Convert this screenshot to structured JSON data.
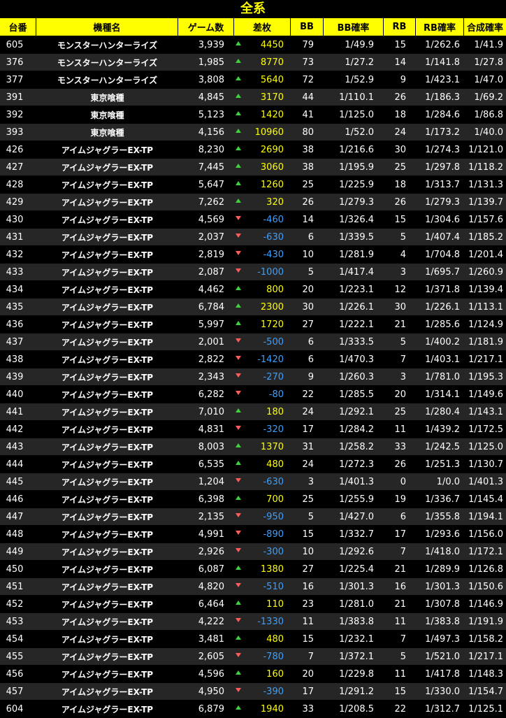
{
  "title": "全系",
  "colors": {
    "header_bg": "#ffff00",
    "positive_value": "#ffff00",
    "negative_value": "#3aa0ff",
    "up_arrow": "#3bd23b",
    "down_arrow": "#ff5c5c"
  },
  "headers": {
    "no": "台番",
    "name": "機種名",
    "games": "ゲーム数",
    "diff": "差枚",
    "bb": "BB",
    "bb_prob": "BB確率",
    "rb": "RB",
    "rb_prob": "RB確率",
    "total_prob": "合成確率"
  },
  "rows": [
    {
      "no": "605",
      "name": "モンスターハンターライズ",
      "games": "3,939",
      "diff": "4450",
      "dir": "up",
      "bb": "79",
      "bb_prob": "1/49.9",
      "rb": "15",
      "rb_prob": "1/262.6",
      "total_prob": "1/41.9"
    },
    {
      "no": "376",
      "name": "モンスターハンターライズ",
      "games": "1,985",
      "diff": "8770",
      "dir": "up",
      "bb": "73",
      "bb_prob": "1/27.2",
      "rb": "14",
      "rb_prob": "1/141.8",
      "total_prob": "1/27.8"
    },
    {
      "no": "377",
      "name": "モンスターハンターライズ",
      "games": "3,808",
      "diff": "5640",
      "dir": "up",
      "bb": "72",
      "bb_prob": "1/52.9",
      "rb": "9",
      "rb_prob": "1/423.1",
      "total_prob": "1/47.0"
    },
    {
      "no": "391",
      "name": "東京喰種",
      "games": "4,845",
      "diff": "3170",
      "dir": "up",
      "bb": "44",
      "bb_prob": "1/110.1",
      "rb": "26",
      "rb_prob": "1/186.3",
      "total_prob": "1/69.2"
    },
    {
      "no": "392",
      "name": "東京喰種",
      "games": "5,123",
      "diff": "1420",
      "dir": "up",
      "bb": "41",
      "bb_prob": "1/125.0",
      "rb": "18",
      "rb_prob": "1/284.6",
      "total_prob": "1/86.8"
    },
    {
      "no": "393",
      "name": "東京喰種",
      "games": "4,156",
      "diff": "10960",
      "dir": "up",
      "bb": "80",
      "bb_prob": "1/52.0",
      "rb": "24",
      "rb_prob": "1/173.2",
      "total_prob": "1/40.0"
    },
    {
      "no": "426",
      "name": "アイムジャグラーEX-TP",
      "games": "8,230",
      "diff": "2690",
      "dir": "up",
      "bb": "38",
      "bb_prob": "1/216.6",
      "rb": "30",
      "rb_prob": "1/274.3",
      "total_prob": "1/121.0"
    },
    {
      "no": "427",
      "name": "アイムジャグラーEX-TP",
      "games": "7,445",
      "diff": "3060",
      "dir": "up",
      "bb": "38",
      "bb_prob": "1/195.9",
      "rb": "25",
      "rb_prob": "1/297.8",
      "total_prob": "1/118.2"
    },
    {
      "no": "428",
      "name": "アイムジャグラーEX-TP",
      "games": "5,647",
      "diff": "1260",
      "dir": "up",
      "bb": "25",
      "bb_prob": "1/225.9",
      "rb": "18",
      "rb_prob": "1/313.7",
      "total_prob": "1/131.3"
    },
    {
      "no": "429",
      "name": "アイムジャグラーEX-TP",
      "games": "7,262",
      "diff": "320",
      "dir": "up",
      "bb": "26",
      "bb_prob": "1/279.3",
      "rb": "26",
      "rb_prob": "1/279.3",
      "total_prob": "1/139.7"
    },
    {
      "no": "430",
      "name": "アイムジャグラーEX-TP",
      "games": "4,569",
      "diff": "-460",
      "dir": "down",
      "bb": "14",
      "bb_prob": "1/326.4",
      "rb": "15",
      "rb_prob": "1/304.6",
      "total_prob": "1/157.6"
    },
    {
      "no": "431",
      "name": "アイムジャグラーEX-TP",
      "games": "2,037",
      "diff": "-630",
      "dir": "down",
      "bb": "6",
      "bb_prob": "1/339.5",
      "rb": "5",
      "rb_prob": "1/407.4",
      "total_prob": "1/185.2"
    },
    {
      "no": "432",
      "name": "アイムジャグラーEX-TP",
      "games": "2,819",
      "diff": "-430",
      "dir": "down",
      "bb": "10",
      "bb_prob": "1/281.9",
      "rb": "4",
      "rb_prob": "1/704.8",
      "total_prob": "1/201.4"
    },
    {
      "no": "433",
      "name": "アイムジャグラーEX-TP",
      "games": "2,087",
      "diff": "-1000",
      "dir": "down",
      "bb": "5",
      "bb_prob": "1/417.4",
      "rb": "3",
      "rb_prob": "1/695.7",
      "total_prob": "1/260.9"
    },
    {
      "no": "434",
      "name": "アイムジャグラーEX-TP",
      "games": "4,462",
      "diff": "800",
      "dir": "up",
      "bb": "20",
      "bb_prob": "1/223.1",
      "rb": "12",
      "rb_prob": "1/371.8",
      "total_prob": "1/139.4"
    },
    {
      "no": "435",
      "name": "アイムジャグラーEX-TP",
      "games": "6,784",
      "diff": "2300",
      "dir": "up",
      "bb": "30",
      "bb_prob": "1/226.1",
      "rb": "30",
      "rb_prob": "1/226.1",
      "total_prob": "1/113.1"
    },
    {
      "no": "436",
      "name": "アイムジャグラーEX-TP",
      "games": "5,997",
      "diff": "1720",
      "dir": "up",
      "bb": "27",
      "bb_prob": "1/222.1",
      "rb": "21",
      "rb_prob": "1/285.6",
      "total_prob": "1/124.9"
    },
    {
      "no": "437",
      "name": "アイムジャグラーEX-TP",
      "games": "2,001",
      "diff": "-500",
      "dir": "down",
      "bb": "6",
      "bb_prob": "1/333.5",
      "rb": "5",
      "rb_prob": "1/400.2",
      "total_prob": "1/181.9"
    },
    {
      "no": "438",
      "name": "アイムジャグラーEX-TP",
      "games": "2,822",
      "diff": "-1420",
      "dir": "down",
      "bb": "6",
      "bb_prob": "1/470.3",
      "rb": "7",
      "rb_prob": "1/403.1",
      "total_prob": "1/217.1"
    },
    {
      "no": "439",
      "name": "アイムジャグラーEX-TP",
      "games": "2,343",
      "diff": "-270",
      "dir": "down",
      "bb": "9",
      "bb_prob": "1/260.3",
      "rb": "3",
      "rb_prob": "1/781.0",
      "total_prob": "1/195.3"
    },
    {
      "no": "440",
      "name": "アイムジャグラーEX-TP",
      "games": "6,282",
      "diff": "-80",
      "dir": "down",
      "bb": "22",
      "bb_prob": "1/285.5",
      "rb": "20",
      "rb_prob": "1/314.1",
      "total_prob": "1/149.6"
    },
    {
      "no": "441",
      "name": "アイムジャグラーEX-TP",
      "games": "7,010",
      "diff": "180",
      "dir": "up",
      "bb": "24",
      "bb_prob": "1/292.1",
      "rb": "25",
      "rb_prob": "1/280.4",
      "total_prob": "1/143.1"
    },
    {
      "no": "442",
      "name": "アイムジャグラーEX-TP",
      "games": "4,831",
      "diff": "-320",
      "dir": "down",
      "bb": "17",
      "bb_prob": "1/284.2",
      "rb": "11",
      "rb_prob": "1/439.2",
      "total_prob": "1/172.5"
    },
    {
      "no": "443",
      "name": "アイムジャグラーEX-TP",
      "games": "8,003",
      "diff": "1370",
      "dir": "up",
      "bb": "31",
      "bb_prob": "1/258.2",
      "rb": "33",
      "rb_prob": "1/242.5",
      "total_prob": "1/125.0"
    },
    {
      "no": "444",
      "name": "アイムジャグラーEX-TP",
      "games": "6,535",
      "diff": "480",
      "dir": "up",
      "bb": "24",
      "bb_prob": "1/272.3",
      "rb": "26",
      "rb_prob": "1/251.3",
      "total_prob": "1/130.7"
    },
    {
      "no": "445",
      "name": "アイムジャグラーEX-TP",
      "games": "1,204",
      "diff": "-630",
      "dir": "down",
      "bb": "3",
      "bb_prob": "1/401.3",
      "rb": "0",
      "rb_prob": "1/0.0",
      "total_prob": "1/401.3"
    },
    {
      "no": "446",
      "name": "アイムジャグラーEX-TP",
      "games": "6,398",
      "diff": "700",
      "dir": "up",
      "bb": "25",
      "bb_prob": "1/255.9",
      "rb": "19",
      "rb_prob": "1/336.7",
      "total_prob": "1/145.4"
    },
    {
      "no": "447",
      "name": "アイムジャグラーEX-TP",
      "games": "2,135",
      "diff": "-950",
      "dir": "down",
      "bb": "5",
      "bb_prob": "1/427.0",
      "rb": "6",
      "rb_prob": "1/355.8",
      "total_prob": "1/194.1"
    },
    {
      "no": "448",
      "name": "アイムジャグラーEX-TP",
      "games": "4,991",
      "diff": "-890",
      "dir": "down",
      "bb": "15",
      "bb_prob": "1/332.7",
      "rb": "17",
      "rb_prob": "1/293.6",
      "total_prob": "1/156.0"
    },
    {
      "no": "449",
      "name": "アイムジャグラーEX-TP",
      "games": "2,926",
      "diff": "-300",
      "dir": "down",
      "bb": "10",
      "bb_prob": "1/292.6",
      "rb": "7",
      "rb_prob": "1/418.0",
      "total_prob": "1/172.1"
    },
    {
      "no": "450",
      "name": "アイムジャグラーEX-TP",
      "games": "6,087",
      "diff": "1380",
      "dir": "up",
      "bb": "27",
      "bb_prob": "1/225.4",
      "rb": "21",
      "rb_prob": "1/289.9",
      "total_prob": "1/126.8"
    },
    {
      "no": "451",
      "name": "アイムジャグラーEX-TP",
      "games": "4,820",
      "diff": "-510",
      "dir": "down",
      "bb": "16",
      "bb_prob": "1/301.3",
      "rb": "16",
      "rb_prob": "1/301.3",
      "total_prob": "1/150.6"
    },
    {
      "no": "452",
      "name": "アイムジャグラーEX-TP",
      "games": "6,464",
      "diff": "110",
      "dir": "up",
      "bb": "23",
      "bb_prob": "1/281.0",
      "rb": "21",
      "rb_prob": "1/307.8",
      "total_prob": "1/146.9"
    },
    {
      "no": "453",
      "name": "アイムジャグラーEX-TP",
      "games": "4,222",
      "diff": "-1330",
      "dir": "down",
      "bb": "11",
      "bb_prob": "1/383.8",
      "rb": "11",
      "rb_prob": "1/383.8",
      "total_prob": "1/191.9"
    },
    {
      "no": "454",
      "name": "アイムジャグラーEX-TP",
      "games": "3,481",
      "diff": "480",
      "dir": "up",
      "bb": "15",
      "bb_prob": "1/232.1",
      "rb": "7",
      "rb_prob": "1/497.3",
      "total_prob": "1/158.2"
    },
    {
      "no": "455",
      "name": "アイムジャグラーEX-TP",
      "games": "2,605",
      "diff": "-780",
      "dir": "down",
      "bb": "7",
      "bb_prob": "1/372.1",
      "rb": "5",
      "rb_prob": "1/521.0",
      "total_prob": "1/217.1"
    },
    {
      "no": "456",
      "name": "アイムジャグラーEX-TP",
      "games": "4,596",
      "diff": "160",
      "dir": "up",
      "bb": "20",
      "bb_prob": "1/229.8",
      "rb": "11",
      "rb_prob": "1/417.8",
      "total_prob": "1/148.3"
    },
    {
      "no": "457",
      "name": "アイムジャグラーEX-TP",
      "games": "4,950",
      "diff": "-390",
      "dir": "down",
      "bb": "17",
      "bb_prob": "1/291.2",
      "rb": "15",
      "rb_prob": "1/330.0",
      "total_prob": "1/154.7"
    },
    {
      "no": "604",
      "name": "アイムジャグラーEX-TP",
      "games": "6,879",
      "diff": "1940",
      "dir": "up",
      "bb": "33",
      "bb_prob": "1/208.5",
      "rb": "22",
      "rb_prob": "1/312.7",
      "total_prob": "1/125.1"
    }
  ]
}
